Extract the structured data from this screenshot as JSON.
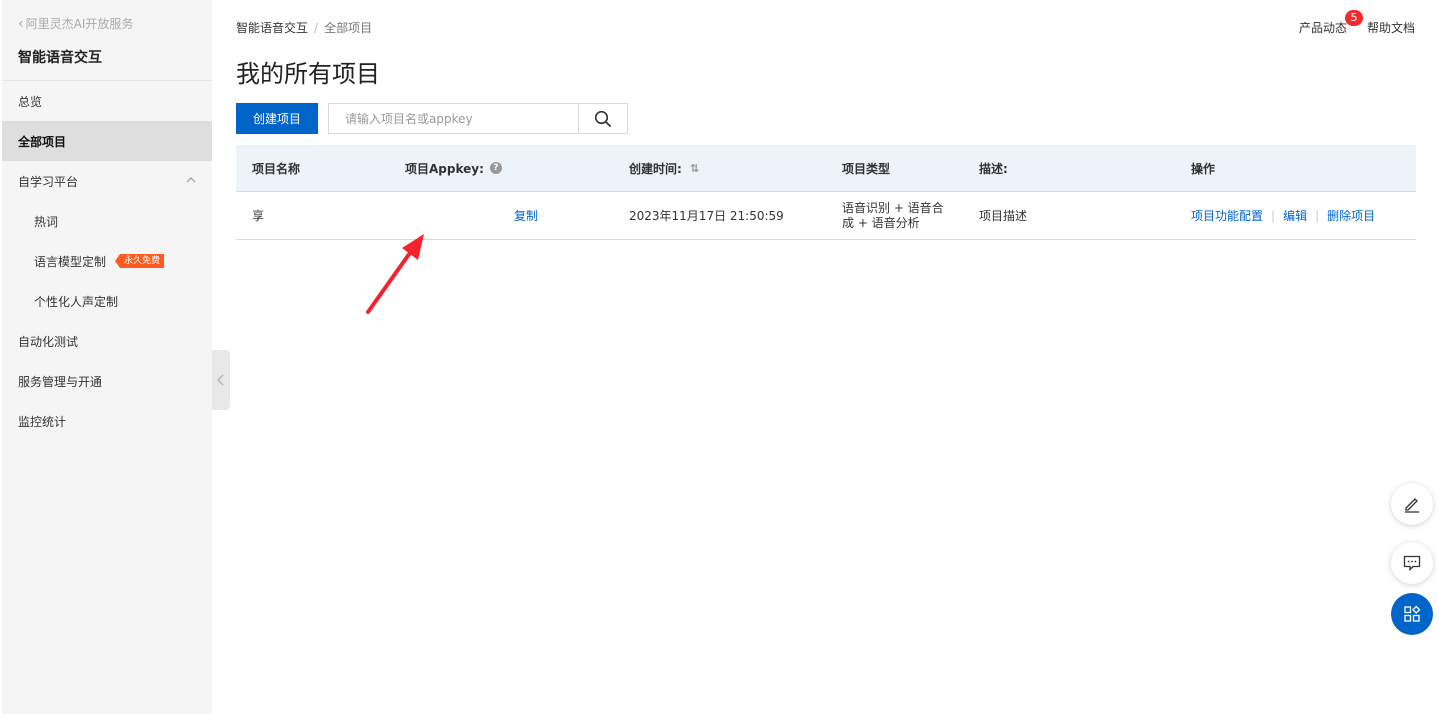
{
  "sidebar": {
    "back_label": "阿里灵杰AI开放服务",
    "title": "智能语音交互",
    "items": [
      {
        "label": "总览"
      },
      {
        "label": "全部项目"
      },
      {
        "label": "自学习平台"
      },
      {
        "label": "热词"
      },
      {
        "label": "语言模型定制",
        "badge": "永久免费"
      },
      {
        "label": "个性化人声定制"
      },
      {
        "label": "自动化测试"
      },
      {
        "label": "服务管理与开通"
      },
      {
        "label": "监控统计"
      }
    ]
  },
  "breadcrumb": {
    "root": "智能语音交互",
    "separator": "/",
    "current": "全部项目"
  },
  "header": {
    "news_label": "产品动态",
    "news_count": "5",
    "help_label": "帮助文档"
  },
  "page_title": "我的所有项目",
  "toolbar": {
    "create_label": "创建项目",
    "search_placeholder": "请输入项目名或appkey"
  },
  "table": {
    "columns": [
      "项目名称",
      "项目Appkey:",
      "创建时间:",
      "项目类型",
      "描述:",
      "操作"
    ],
    "rows": [
      {
        "name": "享",
        "copy_label": "复制",
        "created": "2023年11月17日 21:50:59",
        "type_line1": "语音识别 + 语音合",
        "type_line2": "成 + 语音分析",
        "description": "项目描述",
        "actions": [
          "项目功能配置",
          "编辑",
          "删除项目"
        ]
      }
    ]
  },
  "colors": {
    "primary": "#0064c8",
    "badge": "#f02b2b",
    "free_badge": "#ff5a1f",
    "arrow": "#f5222d"
  },
  "icons": [
    "chevron-left-icon",
    "chevron-up-icon",
    "help-icon",
    "sort-icon",
    "search-icon",
    "edit-icon",
    "feedback-icon",
    "apps-icon"
  ]
}
